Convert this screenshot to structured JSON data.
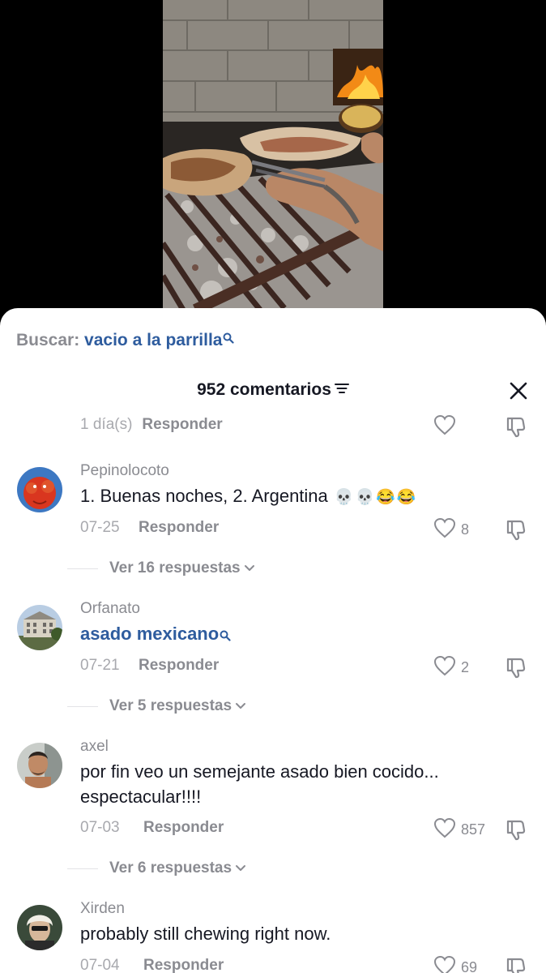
{
  "search": {
    "prefix": "Buscar:",
    "term": "vacio a la parrilla",
    "icon": "search-icon"
  },
  "header": {
    "title": "952 comentarios",
    "filter_icon": "filter-icon",
    "close_icon": "close-icon"
  },
  "partial_comment": {
    "date": "1 día(s)",
    "reply": "Responder"
  },
  "comments": [
    {
      "username": "Pepinolocoto",
      "text": "1. Buenas noches, 2. Argentina",
      "emojis": "💀💀😂😂",
      "date": "07-25",
      "reply": "Responder",
      "likes": "8",
      "more": "Ver 16 respuestas"
    },
    {
      "username": "Orfanato",
      "text": "asado mexicano",
      "date": "07-21",
      "reply": "Responder",
      "likes": "2",
      "more": "Ver 5 respuestas"
    },
    {
      "username": "axel",
      "text": "por fin veo un semejante asado bien cocido... espectacular!!!!",
      "date": "07-03",
      "reply": "Responder",
      "likes": "857",
      "more": "Ver 6 respuestas"
    },
    {
      "username": "Xirden",
      "text": "probably still chewing right now.",
      "date": "07-04",
      "reply": "Responder",
      "likes": "69"
    }
  ],
  "colors": {
    "link": "#2e5c9e",
    "muted": "#8a8b91",
    "text": "#161823"
  }
}
